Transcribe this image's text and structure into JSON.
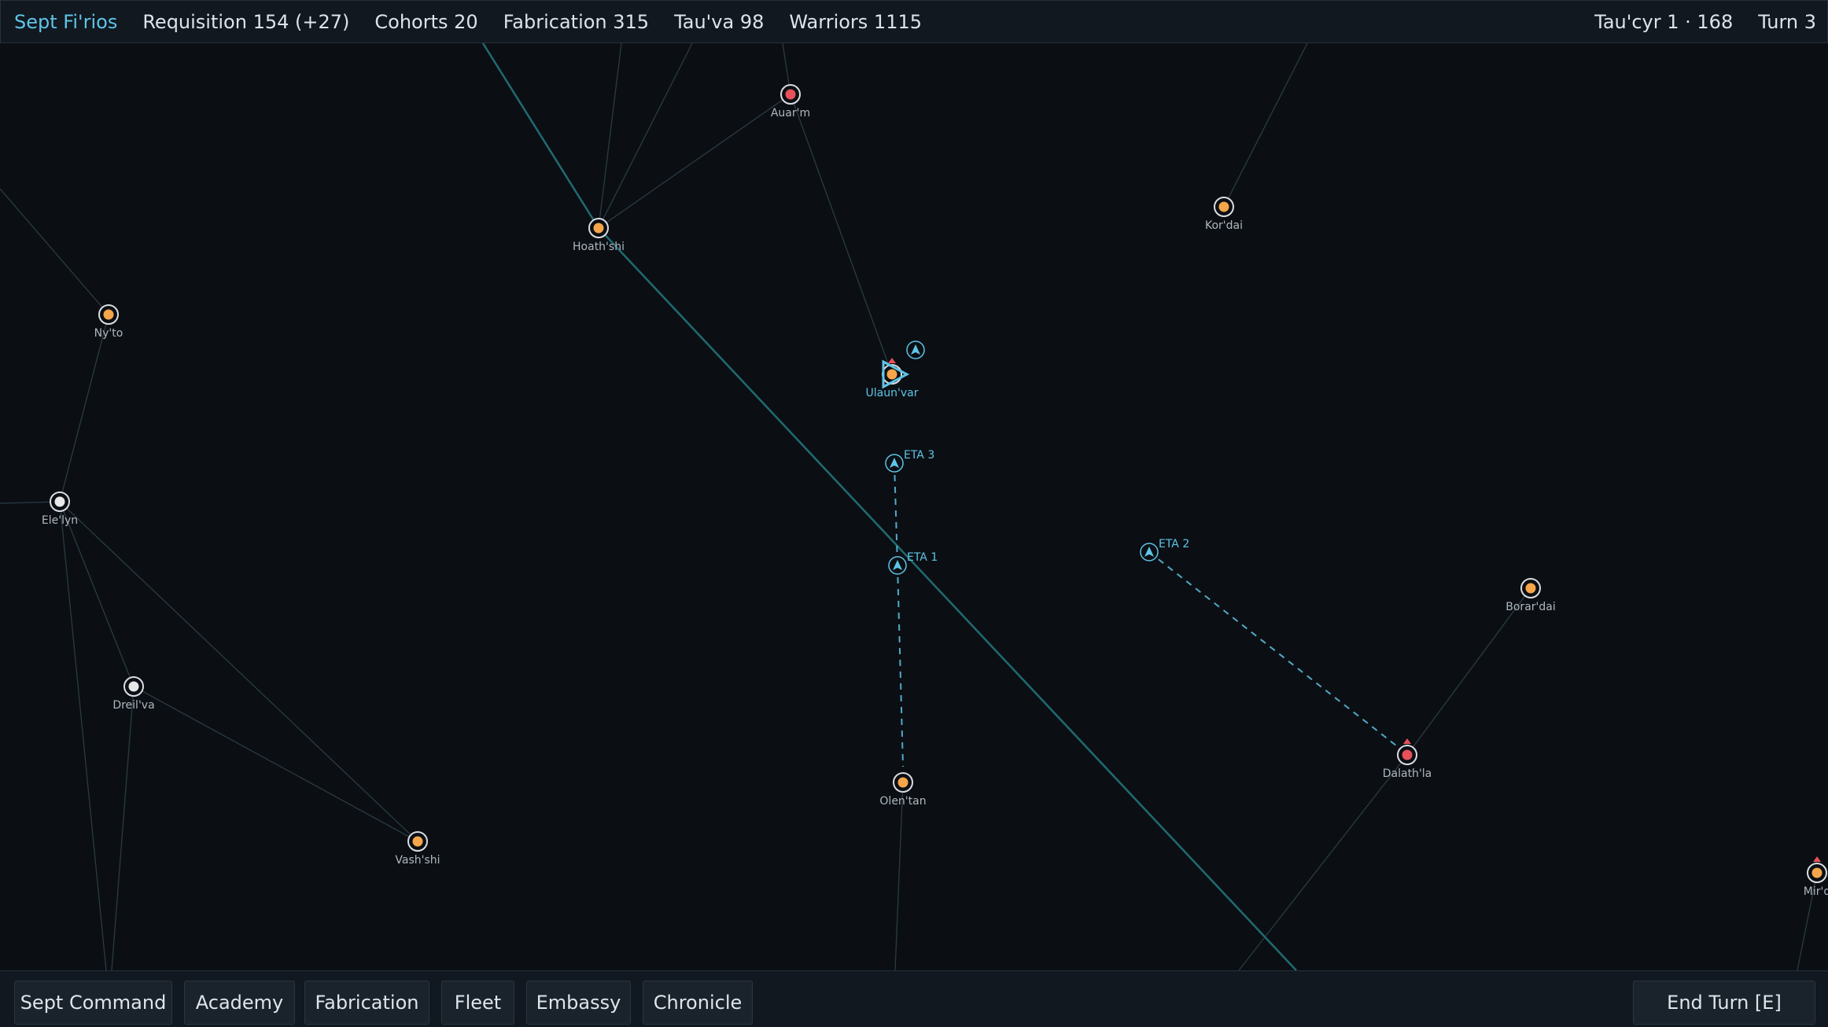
{
  "topbar": {
    "sept": "Sept Fi'rios",
    "requisition": "Requisition 154 (+27)",
    "cohorts": "Cohorts 20",
    "fabrication": "Fabrication 315",
    "tauva": "Tau'va 98",
    "warriors": "Warriors 1115",
    "date": "Tau'cyr 1 · 168",
    "turn": "Turn 3"
  },
  "bottombar": {
    "sept_command": "Sept Command",
    "academy": "Academy",
    "fabrication": "Fabrication",
    "fleet": "Fleet",
    "embassy": "Embassy",
    "chronicle": "Chronicle",
    "end_turn": "End Turn  [E]"
  },
  "colors": {
    "background": "#0b0f14",
    "accent": "#5fc4e6",
    "friendly_system": "#f5a54a",
    "hostile_system": "#e8505a",
    "neutral_system": "#e8e8e8",
    "hyperlane": "#2a3a44",
    "main_route": "#1f6b70"
  },
  "systems": [
    {
      "name": "Auar'm",
      "status": "hostile"
    },
    {
      "name": "Hoath'shi",
      "status": "friendly"
    },
    {
      "name": "Kor'dai",
      "status": "friendly"
    },
    {
      "name": "Ny'to",
      "status": "friendly"
    },
    {
      "name": "Ulaun'var",
      "status": "friendly",
      "selected": true
    },
    {
      "name": "Ele'lyn",
      "status": "neutral"
    },
    {
      "name": "Borar'dai",
      "status": "friendly"
    },
    {
      "name": "Dreil'va",
      "status": "neutral"
    },
    {
      "name": "Dalath'la",
      "status": "hostile"
    },
    {
      "name": "Olen'tan",
      "status": "friendly"
    },
    {
      "name": "Vash'shi",
      "status": "friendly"
    },
    {
      "name": "Mir'd",
      "status": "friendly"
    }
  ],
  "fleets": [
    {
      "label": "",
      "icon": "fleet-arrow-icon"
    },
    {
      "label": "ETA 3",
      "icon": "fleet-arrow-icon"
    },
    {
      "label": "ETA 1",
      "icon": "fleet-arrow-icon"
    },
    {
      "label": "ETA 2",
      "icon": "fleet-arrow-icon"
    }
  ]
}
